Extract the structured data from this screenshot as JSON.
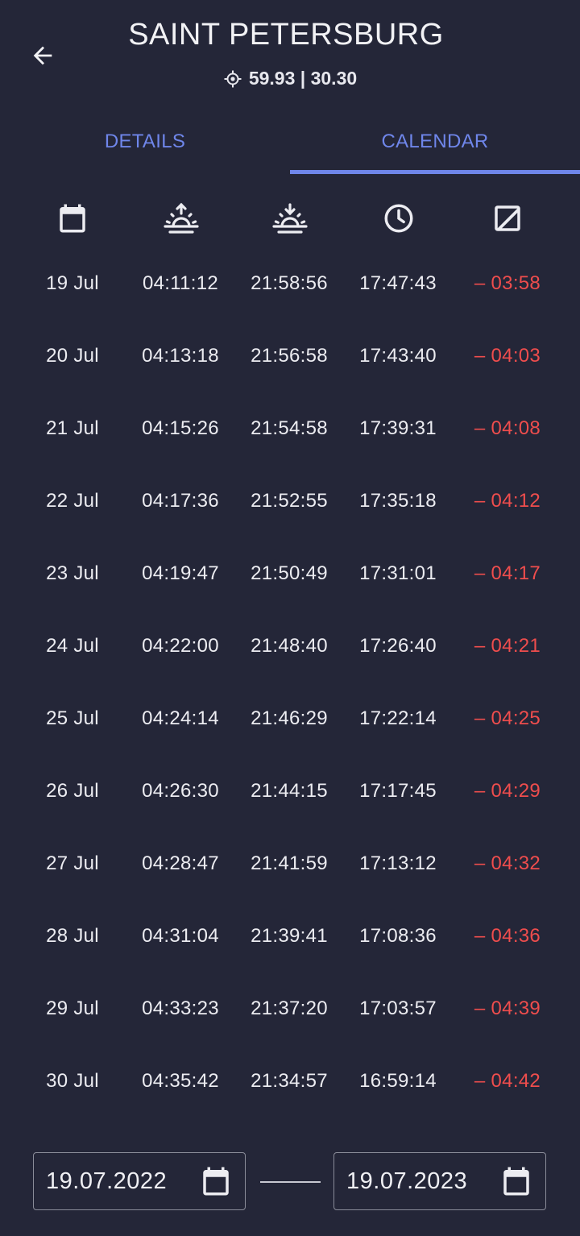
{
  "header": {
    "title": "SAINT PETERSBURG",
    "coordinates": "59.93 | 30.30"
  },
  "tabs": [
    {
      "label": "DETAILS",
      "active": false
    },
    {
      "label": "CALENDAR",
      "active": true
    }
  ],
  "columns": [
    "calendar-icon",
    "sunrise-icon",
    "sunset-icon",
    "clock-icon",
    "exposure-plus-icon"
  ],
  "rows": [
    {
      "date": "19 Jul",
      "sunrise": "04:11:12",
      "sunset": "21:58:56",
      "day_length": "17:47:43",
      "diff": "– 03:58"
    },
    {
      "date": "20 Jul",
      "sunrise": "04:13:18",
      "sunset": "21:56:58",
      "day_length": "17:43:40",
      "diff": "– 04:03"
    },
    {
      "date": "21 Jul",
      "sunrise": "04:15:26",
      "sunset": "21:54:58",
      "day_length": "17:39:31",
      "diff": "– 04:08"
    },
    {
      "date": "22 Jul",
      "sunrise": "04:17:36",
      "sunset": "21:52:55",
      "day_length": "17:35:18",
      "diff": "– 04:12"
    },
    {
      "date": "23 Jul",
      "sunrise": "04:19:47",
      "sunset": "21:50:49",
      "day_length": "17:31:01",
      "diff": "– 04:17"
    },
    {
      "date": "24 Jul",
      "sunrise": "04:22:00",
      "sunset": "21:48:40",
      "day_length": "17:26:40",
      "diff": "– 04:21"
    },
    {
      "date": "25 Jul",
      "sunrise": "04:24:14",
      "sunset": "21:46:29",
      "day_length": "17:22:14",
      "diff": "– 04:25"
    },
    {
      "date": "26 Jul",
      "sunrise": "04:26:30",
      "sunset": "21:44:15",
      "day_length": "17:17:45",
      "diff": "– 04:29"
    },
    {
      "date": "27 Jul",
      "sunrise": "04:28:47",
      "sunset": "21:41:59",
      "day_length": "17:13:12",
      "diff": "– 04:32"
    },
    {
      "date": "28 Jul",
      "sunrise": "04:31:04",
      "sunset": "21:39:41",
      "day_length": "17:08:36",
      "diff": "– 04:36"
    },
    {
      "date": "29 Jul",
      "sunrise": "04:33:23",
      "sunset": "21:37:20",
      "day_length": "17:03:57",
      "diff": "– 04:39"
    },
    {
      "date": "30 Jul",
      "sunrise": "04:35:42",
      "sunset": "21:34:57",
      "day_length": "16:59:14",
      "diff": "– 04:42"
    }
  ],
  "range": {
    "from": "19.07.2022",
    "to": "19.07.2023"
  },
  "colors": {
    "background": "#242638",
    "accent": "#6f86ea",
    "negative": "#ef4d4d",
    "text": "#ececf1"
  }
}
